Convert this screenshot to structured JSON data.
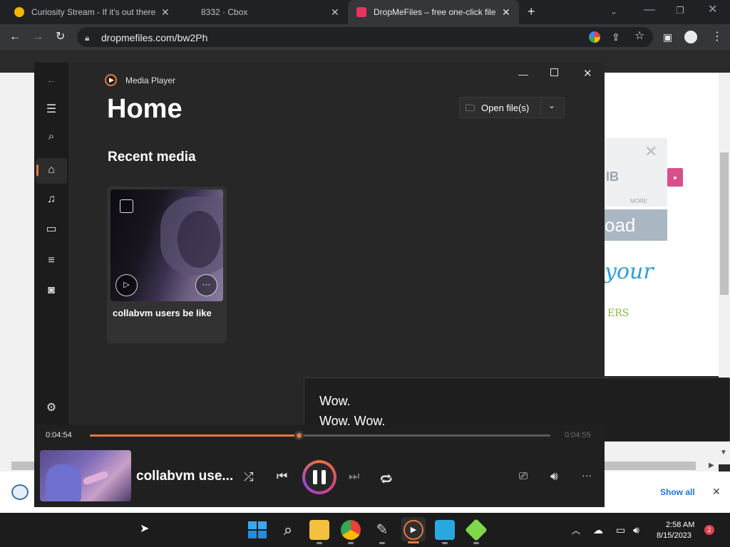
{
  "browser": {
    "tabs": [
      {
        "title": "Curiosity Stream - If it's out there"
      },
      {
        "title": "8332 · Cbox"
      },
      {
        "title": "DropMeFiles – free one-click file"
      }
    ],
    "address": "dropmefiles.com/bw2Ph"
  },
  "webpage": {
    "ad_text_1": "IB",
    "ad_text_2": "MORE",
    "ad_button": "oad",
    "ad_script": "your",
    "ad_script_2": "ERS",
    "downloads_show_all": "Show all"
  },
  "media_player": {
    "app_name": "Media Player",
    "page_title": "Home",
    "open_button": "Open file(s)",
    "section_title": "Recent media",
    "recent": [
      {
        "title": "collabvm users be like"
      }
    ],
    "subtitle_line_1": "Wow.",
    "subtitle_line_2": "Wow. Wow.",
    "time_elapsed": "0:04:54",
    "time_total": "0:04:55",
    "progress_fraction": 0.46,
    "now_playing_title": "collabvm use...",
    "accent_color": "#e9773a"
  },
  "taskbar": {
    "time": "2:58 AM",
    "date": "8/15/2023",
    "notification_count": "2"
  }
}
